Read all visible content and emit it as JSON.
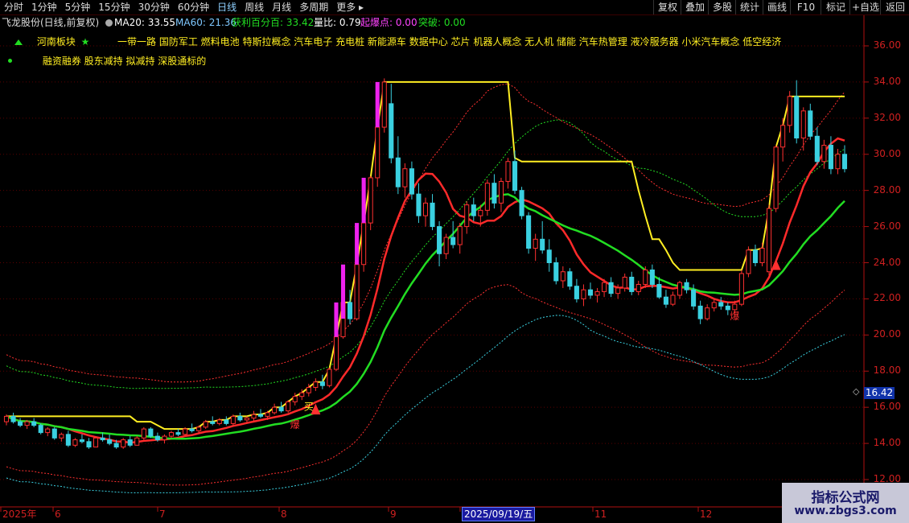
{
  "toolbar": {
    "timeframes": [
      "分时",
      "1分钟",
      "5分钟",
      "15分钟",
      "30分钟",
      "60分钟",
      "日线",
      "周线",
      "月线",
      "多周期",
      "更多"
    ],
    "active": "日线",
    "right_buttons": [
      "复权",
      "叠加",
      "多股",
      "统计",
      "画线",
      "F10",
      "标记",
      "+自选",
      "返回"
    ]
  },
  "header": {
    "stock_name": "飞龙股份(日线,前复权)",
    "ma20": "MA20: 33.55",
    "ma60": "MA60: 21.36",
    "profit_pct": "获利百分百: 33.42",
    "volume_ratio": "量比: 0.79",
    "explosion_point": "起爆点: 0.00",
    "breakthrough": "突破: 0.00"
  },
  "info": {
    "sector_label": "河南板块",
    "concepts": "一带一路 国防军工 燃料电池 特斯拉概念 汽车电子 充电桩 新能源车 数据中心 芯片 机器人概念 无人机 储能 汽车热管理 液冷服务器 小米汽车概念 低空经济",
    "margin_line": "融资融券 股东减持 拟减持 深股通标的"
  },
  "colors": {
    "up": "#ff3030",
    "down": "#3ad0e0",
    "ma20": "#ff2a2a",
    "ma60": "#22dd22",
    "line_yellow": "#ffee22",
    "axis": "#d02020"
  },
  "chart_data": {
    "type": "candlestick",
    "title": "飞龙股份(日线,前复权)",
    "ylim": [
      12,
      36.5
    ],
    "y_ticks": [
      "36.00",
      "34.00",
      "32.00",
      "30.00",
      "28.00",
      "26.00",
      "24.00",
      "22.00",
      "20.00",
      "18.00",
      "16.00",
      "14.00",
      "12.00"
    ],
    "x_labels": [
      "2025年",
      "6",
      "7",
      "8",
      "9",
      "2025/09/19/五",
      "11",
      "12"
    ],
    "current_price_tag": "16.42",
    "signals": [
      "爆",
      "爆",
      "买"
    ],
    "candles": [
      [
        15.2,
        15.6,
        15.0,
        15.5
      ],
      [
        15.5,
        15.7,
        15.1,
        15.2
      ],
      [
        15.2,
        15.4,
        14.9,
        15.0
      ],
      [
        15.0,
        15.3,
        14.8,
        15.2
      ],
      [
        15.2,
        15.4,
        14.9,
        15.0
      ],
      [
        15.0,
        15.1,
        14.5,
        14.6
      ],
      [
        14.6,
        14.9,
        14.4,
        14.8
      ],
      [
        14.8,
        14.9,
        14.2,
        14.3
      ],
      [
        14.3,
        14.6,
        14.1,
        14.5
      ],
      [
        14.5,
        14.7,
        13.8,
        13.9
      ],
      [
        13.9,
        14.3,
        13.8,
        14.2
      ],
      [
        14.2,
        14.5,
        14.0,
        14.1
      ],
      [
        14.1,
        14.3,
        13.7,
        13.8
      ],
      [
        13.8,
        14.4,
        13.8,
        14.3
      ],
      [
        14.3,
        14.6,
        14.1,
        14.2
      ],
      [
        14.2,
        14.5,
        13.9,
        14.0
      ],
      [
        14.0,
        14.2,
        13.7,
        13.8
      ],
      [
        13.8,
        14.3,
        13.7,
        14.2
      ],
      [
        14.2,
        14.4,
        13.8,
        13.9
      ],
      [
        13.9,
        14.4,
        13.9,
        14.3
      ],
      [
        14.3,
        14.9,
        14.2,
        14.8
      ],
      [
        14.8,
        14.9,
        14.3,
        14.4
      ],
      [
        14.4,
        14.6,
        14.1,
        14.2
      ],
      [
        14.2,
        14.5,
        14.0,
        14.4
      ],
      [
        14.4,
        14.7,
        14.3,
        14.6
      ],
      [
        14.6,
        14.8,
        14.4,
        14.5
      ],
      [
        14.5,
        14.9,
        14.4,
        14.8
      ],
      [
        14.8,
        15.1,
        14.6,
        14.7
      ],
      [
        14.7,
        15.0,
        14.6,
        14.9
      ],
      [
        14.9,
        15.3,
        14.8,
        15.2
      ],
      [
        15.2,
        15.5,
        15.0,
        15.1
      ],
      [
        15.1,
        15.4,
        15.0,
        15.3
      ],
      [
        15.3,
        15.5,
        15.0,
        15.1
      ],
      [
        15.1,
        15.6,
        15.0,
        15.5
      ],
      [
        15.5,
        15.7,
        15.2,
        15.3
      ],
      [
        15.3,
        15.5,
        15.1,
        15.4
      ],
      [
        15.4,
        15.8,
        15.2,
        15.6
      ],
      [
        15.6,
        15.9,
        15.4,
        15.5
      ],
      [
        15.5,
        15.8,
        15.3,
        15.7
      ],
      [
        15.7,
        16.2,
        15.6,
        16.0
      ],
      [
        16.0,
        16.3,
        15.7,
        15.8
      ],
      [
        15.8,
        16.4,
        15.7,
        16.3
      ],
      [
        16.3,
        16.8,
        16.1,
        16.6
      ],
      [
        16.6,
        17.0,
        16.4,
        16.8
      ],
      [
        16.8,
        17.3,
        16.6,
        17.1
      ],
      [
        17.1,
        17.6,
        16.9,
        17.4
      ],
      [
        17.4,
        17.8,
        17.0,
        17.2
      ],
      [
        17.2,
        18.2,
        17.1,
        18.1
      ],
      [
        18.1,
        20.0,
        18.0,
        19.9
      ],
      [
        19.9,
        21.9,
        19.8,
        21.8
      ],
      [
        21.8,
        22.5,
        20.6,
        20.9
      ],
      [
        20.9,
        24.0,
        20.8,
        23.9
      ],
      [
        23.9,
        26.3,
        23.5,
        26.2
      ],
      [
        26.2,
        28.8,
        25.8,
        28.7
      ],
      [
        28.7,
        31.6,
        28.2,
        31.5
      ],
      [
        31.5,
        34.2,
        31.2,
        34.0
      ],
      [
        32.8,
        33.9,
        29.5,
        29.8
      ],
      [
        29.8,
        31.0,
        27.8,
        28.2
      ],
      [
        28.2,
        29.5,
        27.6,
        29.2
      ],
      [
        29.2,
        29.6,
        27.5,
        27.8
      ],
      [
        27.8,
        28.4,
        26.2,
        26.6
      ],
      [
        26.6,
        27.6,
        26.0,
        27.3
      ],
      [
        27.3,
        27.8,
        25.8,
        26.0
      ],
      [
        26.0,
        26.3,
        23.8,
        24.5
      ],
      [
        24.5,
        25.6,
        24.2,
        25.4
      ],
      [
        25.4,
        26.3,
        24.8,
        25.0
      ],
      [
        25.0,
        26.2,
        24.5,
        26.0
      ],
      [
        26.0,
        27.4,
        25.6,
        27.2
      ],
      [
        27.2,
        27.6,
        26.3,
        26.6
      ],
      [
        26.6,
        27.2,
        26.0,
        26.9
      ],
      [
        26.9,
        28.6,
        26.6,
        28.4
      ],
      [
        28.4,
        28.9,
        27.0,
        27.3
      ],
      [
        27.3,
        28.7,
        26.8,
        28.5
      ],
      [
        28.5,
        29.8,
        28.1,
        29.6
      ],
      [
        29.6,
        30.2,
        27.8,
        28.0
      ],
      [
        28.0,
        28.2,
        26.4,
        26.6
      ],
      [
        26.6,
        26.8,
        24.5,
        24.8
      ],
      [
        24.8,
        25.6,
        24.1,
        25.3
      ],
      [
        25.3,
        26.3,
        24.5,
        24.7
      ],
      [
        24.7,
        25.3,
        23.5,
        24.0
      ],
      [
        24.0,
        24.3,
        22.8,
        23.0
      ],
      [
        23.0,
        23.8,
        22.6,
        23.5
      ],
      [
        23.5,
        23.7,
        22.5,
        22.7
      ],
      [
        22.7,
        23.1,
        21.8,
        22.0
      ],
      [
        22.0,
        22.8,
        21.6,
        22.5
      ],
      [
        22.5,
        22.9,
        22.0,
        22.2
      ],
      [
        22.2,
        22.6,
        21.8,
        22.4
      ],
      [
        22.4,
        23.1,
        22.1,
        22.9
      ],
      [
        22.9,
        23.2,
        22.1,
        22.3
      ],
      [
        22.3,
        22.8,
        22.0,
        22.6
      ],
      [
        22.6,
        23.4,
        22.4,
        23.2
      ],
      [
        23.2,
        23.5,
        22.2,
        22.4
      ],
      [
        22.4,
        23.0,
        22.2,
        22.8
      ],
      [
        22.8,
        23.8,
        22.6,
        23.6
      ],
      [
        23.6,
        23.9,
        22.6,
        22.8
      ],
      [
        22.8,
        23.2,
        22.0,
        22.1
      ],
      [
        22.1,
        22.5,
        21.5,
        21.7
      ],
      [
        21.7,
        22.4,
        21.6,
        22.2
      ],
      [
        22.2,
        23.0,
        22.0,
        22.9
      ],
      [
        22.9,
        23.1,
        22.3,
        22.5
      ],
      [
        22.5,
        22.8,
        21.4,
        21.6
      ],
      [
        21.6,
        21.9,
        20.6,
        20.9
      ],
      [
        20.9,
        21.7,
        20.8,
        21.5
      ],
      [
        21.5,
        22.0,
        21.3,
        21.8
      ],
      [
        21.8,
        22.1,
        21.4,
        21.6
      ],
      [
        21.6,
        21.8,
        21.1,
        21.4
      ],
      [
        21.4,
        21.9,
        21.2,
        21.7
      ],
      [
        21.7,
        23.6,
        21.6,
        23.4
      ],
      [
        23.4,
        24.9,
        23.2,
        24.7
      ],
      [
        24.7,
        25.0,
        23.8,
        24.0
      ],
      [
        24.0,
        25.1,
        23.8,
        24.8
      ],
      [
        23.5,
        27.2,
        23.3,
        27.0
      ],
      [
        27.0,
        30.5,
        26.8,
        30.4
      ],
      [
        30.4,
        32.0,
        29.6,
        31.6
      ],
      [
        31.6,
        33.5,
        31.2,
        33.2
      ],
      [
        33.2,
        34.1,
        30.6,
        30.9
      ],
      [
        30.9,
        32.6,
        30.2,
        32.4
      ],
      [
        32.4,
        32.8,
        30.8,
        31.0
      ],
      [
        31.0,
        31.5,
        29.4,
        29.6
      ],
      [
        29.6,
        30.8,
        29.2,
        30.5
      ],
      [
        30.5,
        31.0,
        28.9,
        29.2
      ],
      [
        29.2,
        30.3,
        28.9,
        30.0
      ],
      [
        30.0,
        30.5,
        29.0,
        29.2
      ]
    ]
  }
}
